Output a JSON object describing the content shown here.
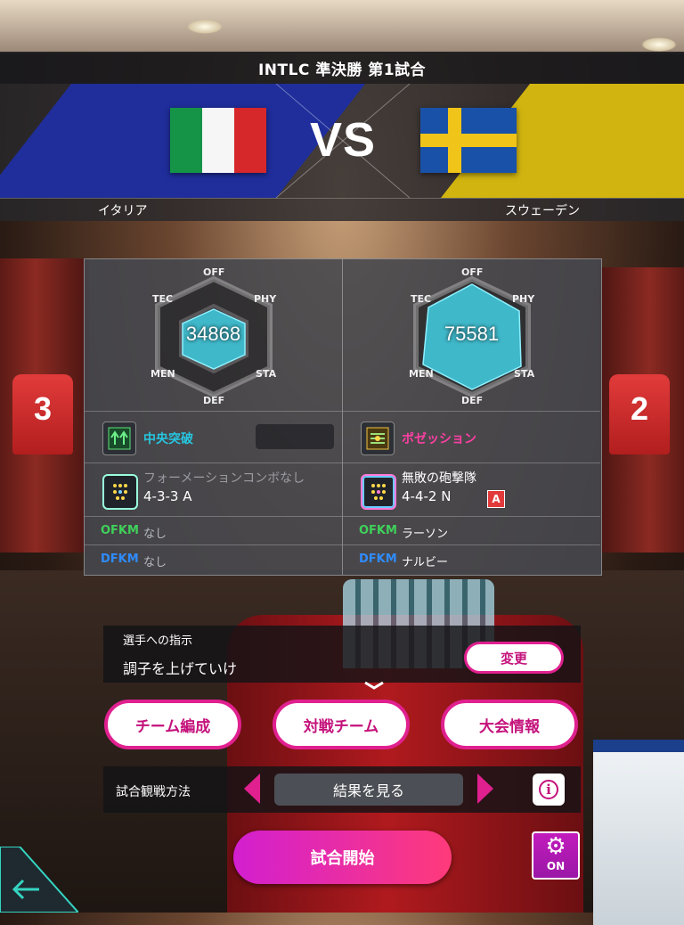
{
  "header": {
    "title": "INTLC 準決勝 第1試合"
  },
  "match": {
    "vs": "VS",
    "home": {
      "name": "イタリア",
      "flag": "italy-flag"
    },
    "away": {
      "name": "スウェーデン",
      "flag": "sweden-flag"
    }
  },
  "radar_labels": {
    "off": "OFF",
    "phy": "PHY",
    "sta": "STA",
    "def": "DEF",
    "men": "MEN",
    "tec": "TEC"
  },
  "home_team": {
    "power": "34868",
    "tactic": "中央突破",
    "combo": "フォーメーションコンボなし",
    "formation": "4-3-3 A",
    "ofkm_label": "OFKM",
    "ofkm": "なし",
    "dfkm_label": "DFKM",
    "dfkm": "なし",
    "tactic_color": "#26c6e0"
  },
  "away_team": {
    "power": "75581",
    "tactic": "ポゼッション",
    "combo": "無敗の砲撃隊",
    "formation": "4-4-2 N",
    "formation_badge": "A",
    "ofkm_label": "OFKM",
    "ofkm": "ラーソン",
    "dfkm_label": "DFKM",
    "dfkm": "ナルビー",
    "tactic_color": "#ff3fa4"
  },
  "instructions": {
    "label": "選手への指示",
    "value": "調子を上げていけ",
    "change": "変更"
  },
  "menu": {
    "team": "チーム編成",
    "opponent": "対戦チーム",
    "tournament": "大会情報"
  },
  "watch": {
    "label": "試合観戦方法",
    "value": "結果を見る",
    "info": "i"
  },
  "start": "試合開始",
  "auto": {
    "state": "ON"
  },
  "colors": {
    "accent": "#e0208f",
    "ofkm": "#3fd15a",
    "dfkm": "#2f8cff"
  }
}
